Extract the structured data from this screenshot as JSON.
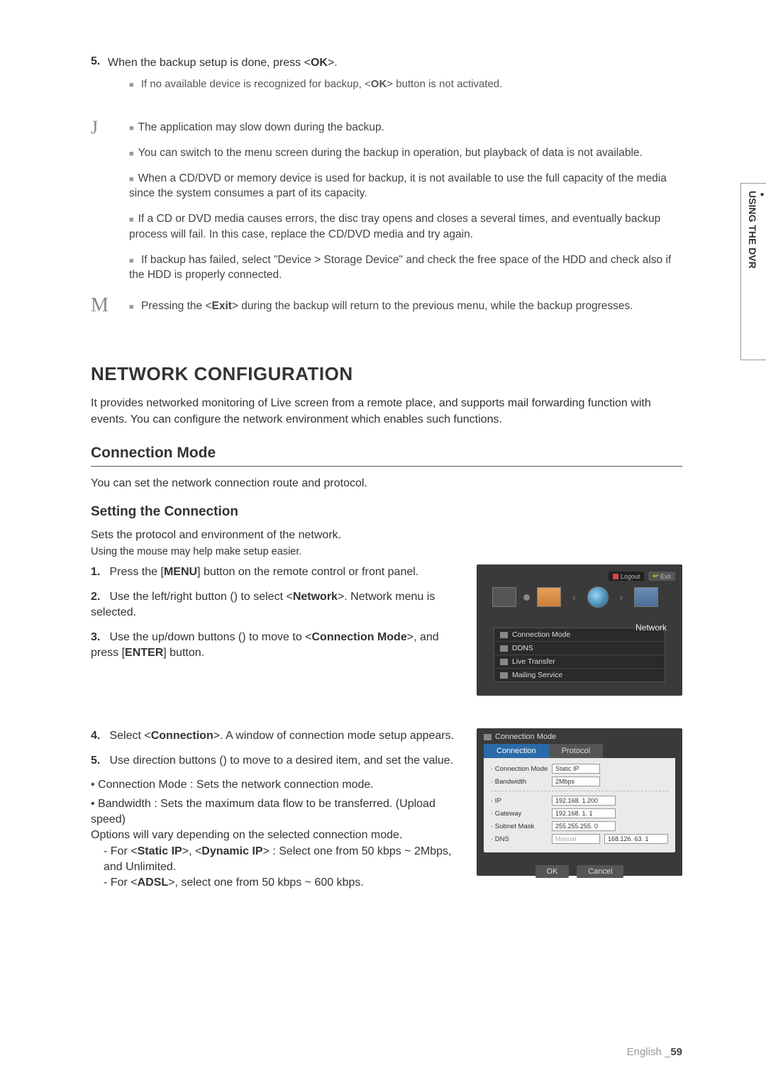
{
  "side_label": "USING THE DVR",
  "top": {
    "step5_num": "5.",
    "step5_text_a": "When the backup setup is done, press <",
    "step5_text_b": ">.",
    "step5_ok": "OK",
    "sub_note_a": "If no available device is recognized for backup, <",
    "sub_note_ok": "OK",
    "sub_note_b": "> button is not activated."
  },
  "j_notes": {
    "0": "The application may slow down during the backup.",
    "1": "You can switch to the menu screen during the backup in operation, but playback of data is not available.",
    "2": "When a CD/DVD or memory device is used for backup, it is not available to use the full capacity of the media since the system consumes a part of its capacity.",
    "3": "If a CD or DVD media causes errors, the disc tray opens and closes a several times, and eventually backup process will fail. In this case, replace the CD/DVD media and try again.",
    "4_a": "If backup has failed, select \"",
    "4_b": "Device > Storage Device",
    "4_c": "\" and check the free space of the HDD and check also if the HDD is properly connected."
  },
  "m_note_a": "Pressing the <",
  "m_note_exit": "Exit",
  "m_note_b": "> during the backup will return to the previous menu, while the backup progresses.",
  "h1": "NETWORK CONFIGURATION",
  "intro": "It provides networked monitoring of Live screen from a remote place, and supports mail forwarding function with events. You can configure the network environment which enables such functions.",
  "h2_conn_mode": "Connection Mode",
  "conn_mode_p": "You can set the network connection route and protocol.",
  "h3_setting": "Setting the Connection",
  "setting_p": "Sets the protocol and environment of the network.",
  "setting_small": "Using the mouse may help make setup easier.",
  "steps1": {
    "1_a": "Press the [",
    "1_menu": "MENU",
    "1_b": "] button on the remote control or front panel.",
    "2_a": "Use the left/right button (",
    "2_b": ") to select <",
    "2_net": "Network",
    "2_c": ">. Network menu is selected.",
    "3_a": "Use the up/down buttons (",
    "3_b": ") to move to <",
    "3_cm": "Connection Mode",
    "3_c": ">, and press [",
    "3_enter": "ENTER",
    "3_d": "] button."
  },
  "ss1": {
    "logout": "Logout",
    "exit": "Exit",
    "network_label": "Network",
    "menu": {
      "0": "Connection Mode",
      "1": "DDNS",
      "2": "Live Transfer",
      "3": "Mailing Service"
    }
  },
  "steps2": {
    "4_a": "Select <",
    "4_conn": "Connection",
    "4_b": ">. A window of connection mode setup appears.",
    "5_a": "Use direction buttons (",
    "5_b": ") to move to a desired item, and set the value."
  },
  "bullets": {
    "b1": "Connection Mode : Sets the network connection mode.",
    "b2": "Bandwidth : Sets the maximum data flow to be transferred. (Upload speed)",
    "b2_sub": "Options will vary depending on the selected connection mode.",
    "d1_a": "For <",
    "d1_s1": "Static IP",
    "d1_b": ">, <",
    "d1_s2": "Dynamic IP",
    "d1_c": "> : Select one from 50 kbps ~ 2Mbps, and Unlimited.",
    "d2_a": "For <",
    "d2_adsl": "ADSL",
    "d2_b": ">, select one from 50 kbps ~ 600 kbps."
  },
  "ss2": {
    "header": "Connection Mode",
    "tab_connection": "Connection",
    "tab_protocol": "Protocol",
    "rows": {
      "conn_mode_lbl": "· Connection Mode",
      "conn_mode_val": "Static IP",
      "bandwidth_lbl": "· Bandwidth",
      "bandwidth_val": "2Mbps",
      "ip_lbl": "· IP",
      "ip_val": "192.168.  1.200",
      "gateway_lbl": "· Gateway",
      "gateway_val": "192.168.  1.   1",
      "subnet_lbl": "· Subnet Mask",
      "subnet_val": "255.255.255.  0",
      "dns_lbl": "· DNS",
      "dns_val1": "Manual",
      "dns_val2": "168.126. 63.   1"
    },
    "ok": "OK",
    "cancel": "Cancel"
  },
  "footer": {
    "lang": "English _",
    "page": "59"
  }
}
